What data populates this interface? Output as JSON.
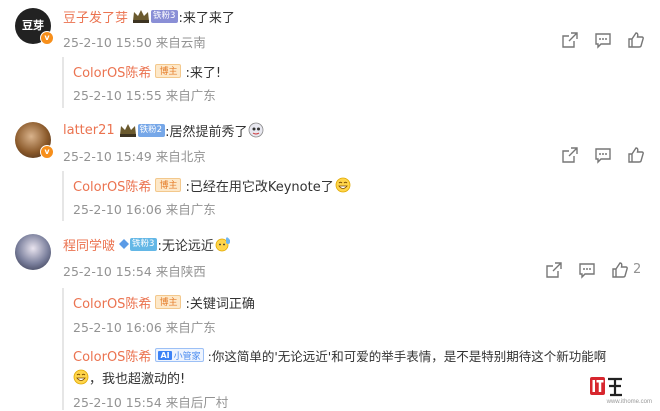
{
  "comments": [
    {
      "user": "豆子发了芽",
      "fan_badge": "铁粉3",
      "text": ":来了来了",
      "meta": "25-2-10 15:50 来自云南",
      "avatar_text": "豆芽",
      "replies": [
        {
          "user": "ColorOS陈希",
          "badge": "博主",
          "text": ":来了!",
          "meta": "25-2-10 15:55 来自广东"
        }
      ]
    },
    {
      "user": "latter21",
      "fan_badge": "铁粉2",
      "text": ":居然提前秀了",
      "meta": "25-2-10 15:49 来自北京",
      "replies": [
        {
          "user": "ColorOS陈希",
          "badge": "博主",
          "text": ":已经在用它改Keynote了",
          "meta": "25-2-10 16:06 来自广东"
        }
      ]
    },
    {
      "user": "程同学啵",
      "fan_badge": "铁粉3",
      "text": ":无论远近",
      "meta": "25-2-10 15:54 来自陕西",
      "like_count": "2",
      "replies": [
        {
          "user": "ColorOS陈希",
          "badge": "博主",
          "text": ":关键词正确",
          "meta": "25-2-10 16:06 来自广东"
        },
        {
          "user": "ColorOS陈希",
          "badge": "小管家",
          "text": ":你这简单的'无论远近'和可爱的举手表情，是不是特别期待这个新功能啊",
          "text2": "，我也超激动的!",
          "meta": "25-2-10 15:54 来自后厂村"
        }
      ]
    }
  ],
  "verified_mark": "v",
  "watermark": {
    "logo_text": "IT之家",
    "url": "www.ithome.com"
  },
  "colors": {
    "username": "#eb7350",
    "meta": "#939393",
    "vbadge": "#f78f1b"
  }
}
